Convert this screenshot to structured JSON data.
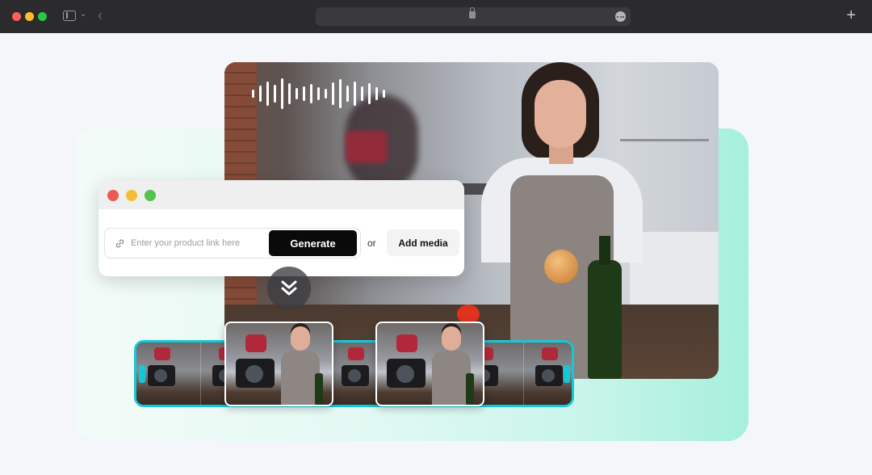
{
  "browser": {
    "icons": {
      "sidebar_toggle": "sidebar-icon",
      "chevron": "chevron-down-icon",
      "back": "back-arrow-icon",
      "lock": "lock-icon",
      "more": "more-icon",
      "new_tab": "plus-icon"
    }
  },
  "prompt": {
    "input_placeholder": "Enter your product link here",
    "generate_label": "Generate",
    "or_label": "or",
    "add_media_label": "Add media"
  },
  "colors": {
    "accent_cyan": "#14c8d8",
    "mint": "#a6efdd",
    "generate_bg": "#0a0a0a"
  }
}
